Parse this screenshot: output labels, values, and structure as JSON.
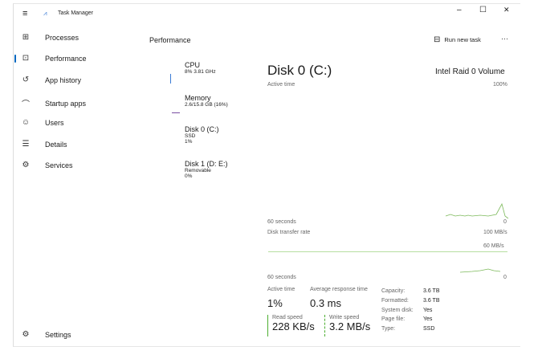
{
  "window": {
    "title": "Task Manager",
    "minimize": "–",
    "maximize": "☐",
    "close": "✕"
  },
  "sidebar": {
    "items": [
      {
        "label": "Processes",
        "icon": "processes-icon",
        "glyph": "⊞"
      },
      {
        "label": "Performance",
        "icon": "performance-icon",
        "glyph": "⊡"
      },
      {
        "label": "App history",
        "icon": "history-icon",
        "glyph": "↺"
      },
      {
        "label": "Startup apps",
        "icon": "startup-icon",
        "glyph": "⌒"
      },
      {
        "label": "Users",
        "icon": "users-icon",
        "glyph": "☺"
      },
      {
        "label": "Details",
        "icon": "details-icon",
        "glyph": "☰"
      },
      {
        "label": "Services",
        "icon": "services-icon",
        "glyph": "⚙"
      }
    ],
    "settings": "Settings"
  },
  "header": {
    "title": "Performance",
    "run_new_task": "Run new task",
    "more": "···"
  },
  "devices": [
    {
      "name": "CPU",
      "line1": "8% 3.81 GHz",
      "line2": ""
    },
    {
      "name": "Memory",
      "line1": "2.6/15.8 GB (16%)",
      "line2": ""
    },
    {
      "name": "Disk 0 (C:)",
      "line1": "SSD",
      "line2": "1%"
    },
    {
      "name": "Disk 1 (D: E:)",
      "line1": "Removable",
      "line2": "0%"
    }
  ],
  "detail": {
    "title": "Disk 0 (C:)",
    "model": "Intel Raid 0 Volume",
    "chart1": {
      "label": "Active time",
      "max": "100%",
      "time": "60 seconds",
      "min": "0"
    },
    "chart2": {
      "label": "Disk transfer rate",
      "max": "100 MB/s",
      "mid": "60 MB/s",
      "time": "60 seconds",
      "min": "0"
    },
    "stats": {
      "active_time_label": "Active time",
      "active_time": "1%",
      "avg_resp_label": "Average response time",
      "avg_resp": "0.3 ms",
      "read_label": "Read speed",
      "read": "228 KB/s",
      "write_label": "Write speed",
      "write": "3.2 MB/s"
    },
    "props": [
      {
        "k": "Capacity:",
        "v": "3.6 TB"
      },
      {
        "k": "Formatted:",
        "v": "3.6 TB"
      },
      {
        "k": "System disk:",
        "v": "Yes"
      },
      {
        "k": "Page file:",
        "v": "Yes"
      },
      {
        "k": "Type:",
        "v": "SSD"
      }
    ]
  },
  "colors": {
    "accent": "#0067c0",
    "disk": "#4cae30"
  }
}
